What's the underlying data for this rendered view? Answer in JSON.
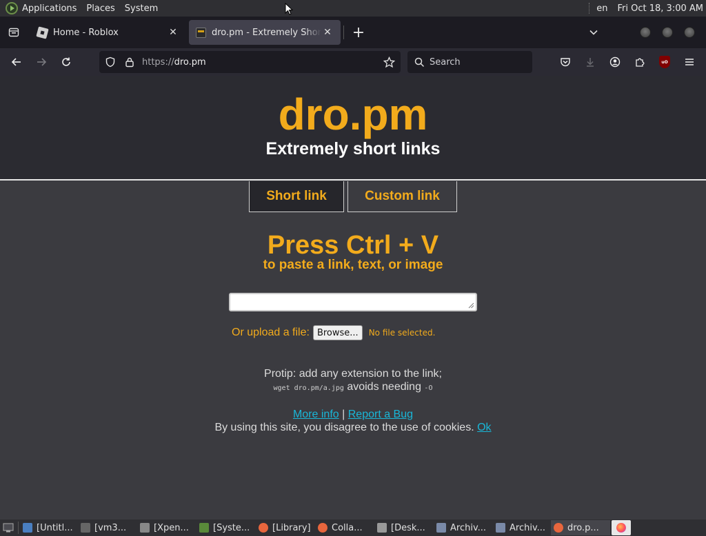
{
  "top_panel": {
    "menus": [
      "Applications",
      "Places",
      "System"
    ],
    "language": "en",
    "clock": "Fri Oct 18,  3:00 AM"
  },
  "browser": {
    "tabs": [
      {
        "title": "Home - Roblox",
        "icon": "roblox-favicon",
        "active": false
      },
      {
        "title": "dro.pm - Extremely Short Links",
        "icon": "dro-favicon",
        "active": true
      }
    ],
    "url_protocol": "https://",
    "url_host": "dro.pm",
    "search_placeholder": "Search"
  },
  "page": {
    "site_title": "dro.pm",
    "site_subtitle": "Extremely short links",
    "mode_tabs": [
      "Short link",
      "Custom link"
    ],
    "press_title": "Press Ctrl + V",
    "press_subtitle": "to paste a link, text, or image",
    "upload_label": "Or upload a file:",
    "browse_button": "Browse...",
    "no_file_text": "No file selected.",
    "protip_line1": "Protip: add any extension to the link;",
    "protip_code1": "wget dro.pm/a.jpg",
    "protip_mid": "avoids needing",
    "protip_code2": "-O",
    "more_info": "More info",
    "separator": "|",
    "report_bug": "Report a Bug",
    "cookie_text": "By using this site, you disagree to the use of cookies.",
    "cookie_ok": "Ok"
  },
  "taskbar": {
    "tasks": [
      {
        "label": "[Untitl...",
        "icon": "document-icon",
        "color": "#4a7fc1"
      },
      {
        "label": "[vm3...",
        "icon": "terminal-icon",
        "color": "#666"
      },
      {
        "label": "[Xpen...",
        "icon": "window-icon",
        "color": "#888"
      },
      {
        "label": "[Syste...",
        "icon": "system-monitor-icon",
        "color": "#5a8a3a"
      },
      {
        "label": "[Library]",
        "icon": "firefox-icon",
        "color": "#e8663d"
      },
      {
        "label": "Colla...",
        "icon": "firefox-icon",
        "color": "#e8663d"
      },
      {
        "label": "[Desk...",
        "icon": "folder-icon",
        "color": "#999"
      },
      {
        "label": "Archiv...",
        "icon": "archive-icon",
        "color": "#7a8aa8"
      },
      {
        "label": "Archiv...",
        "icon": "archive-icon",
        "color": "#7a8aa8"
      },
      {
        "label": "dro.p...",
        "icon": "firefox-icon",
        "color": "#e8663d"
      }
    ]
  },
  "colors": {
    "accent": "#f2ab1c",
    "link": "#19b7d8",
    "header_bg": "#2b2b31",
    "page_bg": "#3b3b40"
  }
}
